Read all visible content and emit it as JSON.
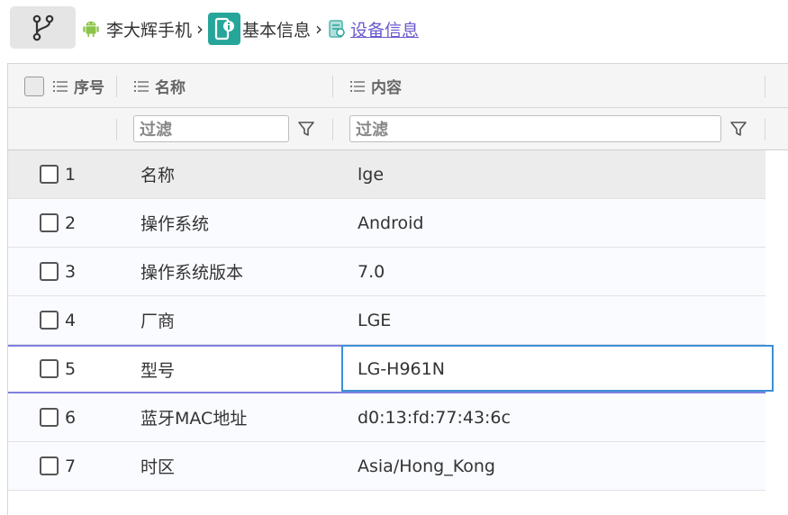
{
  "toolbar": {
    "branch_icon": "git-branch-icon"
  },
  "breadcrumb": {
    "device": "李大辉手机",
    "section": "基本信息",
    "current": "设备信息",
    "separator": "›"
  },
  "grid": {
    "columns": {
      "index": "序号",
      "name": "名称",
      "content": "内容"
    },
    "filter_placeholder": "过滤",
    "rows": [
      {
        "index": "1",
        "name": "名称",
        "value": "lge"
      },
      {
        "index": "2",
        "name": "操作系统",
        "value": "Android"
      },
      {
        "index": "3",
        "name": "操作系统版本",
        "value": "7.0"
      },
      {
        "index": "4",
        "name": "厂商",
        "value": "LGE"
      },
      {
        "index": "5",
        "name": "型号",
        "value": "LG-H961N"
      },
      {
        "index": "6",
        "name": "蓝牙MAC地址",
        "value": "d0:13:fd:77:43:6c"
      },
      {
        "index": "7",
        "name": "时区",
        "value": "Asia/Hong_Kong"
      }
    ]
  },
  "colors": {
    "accent_teal": "#26a69a",
    "link": "#6a5acd",
    "focus": "#3c8fd6",
    "android_green": "#8bc34a"
  }
}
